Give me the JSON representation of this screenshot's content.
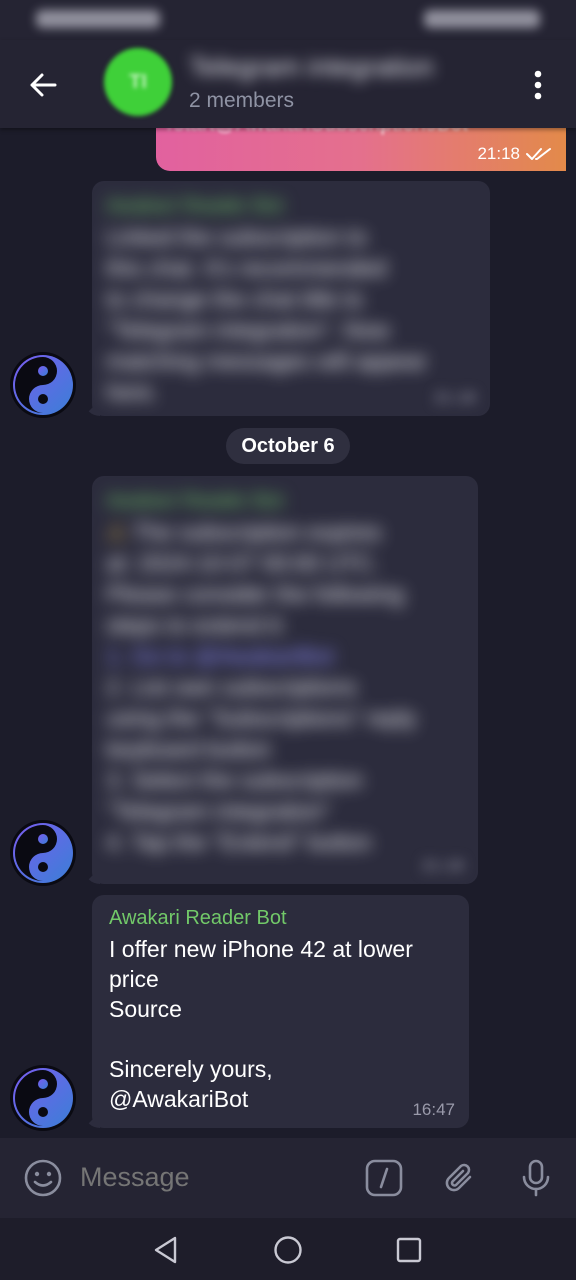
{
  "header": {
    "title": "Telegram integration",
    "members": "2 members"
  },
  "messages": {
    "outgoing": {
      "text": "/start@AwakariSubscriptionsBot",
      "time": "21:18"
    },
    "first": {
      "sender": "Awakari Reader Bot",
      "lines": [
        "Linked the subscription to",
        "this chat. It's recommended",
        "to change the chat title to",
        "\"Telegram integration\". Now",
        "matching messages will appear",
        "here."
      ],
      "time": "21:18"
    },
    "date_separator": "October 6",
    "second": {
      "sender": "Awakari Reader Bot",
      "lines": [
        "The subscription expires",
        "at: 2024-10-07 00:00 UTC.",
        "Please consider the following",
        "steps to extend it:",
        "1. Go to @AwakariBot",
        "2. List own subscriptions",
        "using the \"Subscriptions\" reply",
        "keyboard button",
        "3. Select the subscription",
        "\"Telegram integration\"",
        "4. Tap the \"Extend\" button"
      ],
      "time": "21:18"
    },
    "third": {
      "sender": "Awakari Reader Bot",
      "line1": "I offer new iPhone 42 at lower",
      "line2": "price",
      "link": "Source",
      "closing": "Sincerely yours,",
      "signature": "@AwakariBot",
      "time": "16:47"
    }
  },
  "composer": {
    "placeholder": "Message"
  },
  "colors": {
    "background": "#1c1c2a",
    "header": "#252433",
    "bubble": "#2c2c3d",
    "sender": "#72c969",
    "link": "#8f8eff",
    "accent_avatar": "#3fd039"
  }
}
